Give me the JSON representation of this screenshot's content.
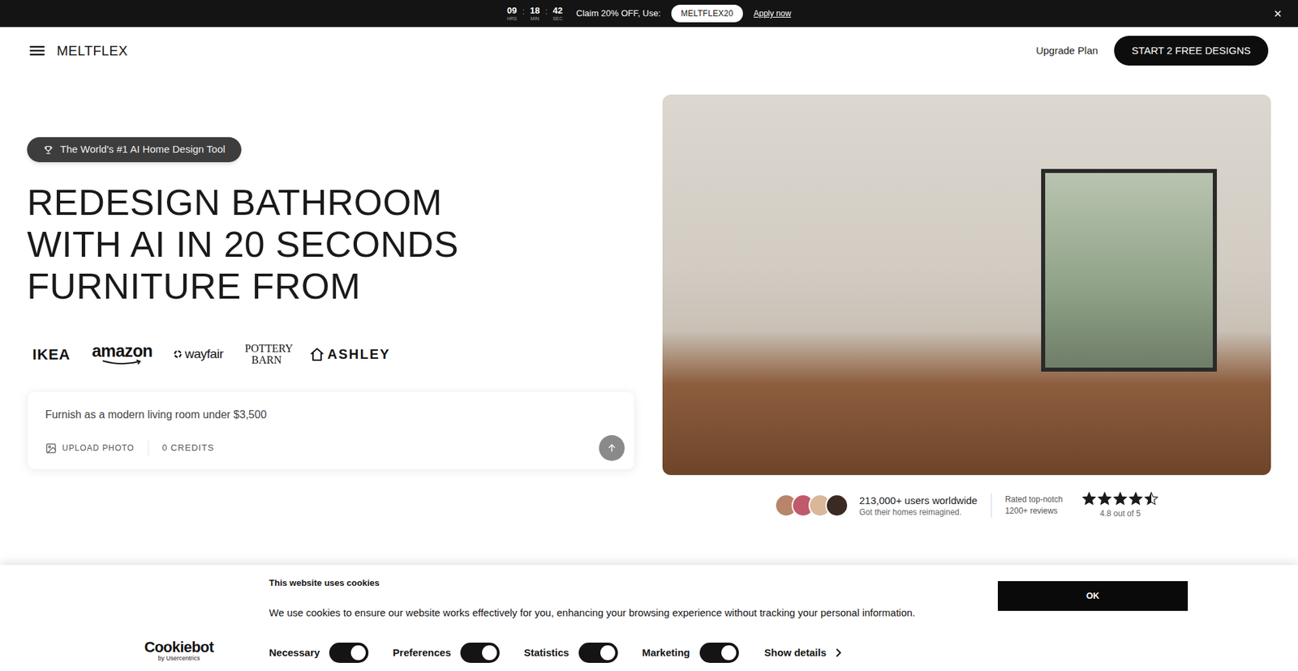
{
  "promo_bar": {
    "timer": [
      {
        "value": "09",
        "unit": "HRS"
      },
      {
        "value": "18",
        "unit": "MIN"
      },
      {
        "value": "42",
        "unit": "SEC"
      }
    ],
    "separator": ":",
    "text": "Claim 20% OFF, Use:",
    "code": "MELTFLEX20",
    "link": "Apply now",
    "close": "×"
  },
  "header": {
    "brand": "MELTFLEX",
    "upgrade": "Upgrade Plan",
    "cta": "START 2 FREE DESIGNS"
  },
  "hero": {
    "badge": "The World's #1 AI Home Design Tool",
    "heading": [
      "REDESIGN BATHROOM",
      "WITH AI IN 20 SECONDS",
      "FURNITURE FROM"
    ],
    "brands": [
      {
        "name": "IKEA",
        "kind": "heavy"
      },
      {
        "name": "amazon",
        "kind": "amazon"
      },
      {
        "name": "wayfair",
        "kind": "wayfair"
      },
      {
        "name": "POTTERY BARN",
        "kind": "serif"
      },
      {
        "name": "ASHLEY",
        "kind": "house"
      }
    ],
    "prompt": {
      "value": "Furnish as a modern living room under $3,500",
      "upload": "UPLOAD PHOTO",
      "credits": "0 CREDITS"
    }
  },
  "social_proof": {
    "users": "213,000+ users worldwide",
    "users_sub": "Got their homes reimagined.",
    "rated": "Rated top-notch",
    "reviews": "1200+ reviews",
    "stars": 4.5,
    "rating": "4.8 out of 5"
  },
  "cookie_banner": {
    "title": "This website uses cookies",
    "text": "We use cookies to ensure our website works effectively for you, enhancing your browsing experience without tracking your personal information.",
    "brand": "Cookiebot",
    "brand_sub": "by Usercentrics",
    "toggles": [
      {
        "label": "Necessary",
        "on": true
      },
      {
        "label": "Preferences",
        "on": true
      },
      {
        "label": "Statistics",
        "on": true
      },
      {
        "label": "Marketing",
        "on": true
      }
    ],
    "details": "Show details",
    "ok": "OK"
  }
}
